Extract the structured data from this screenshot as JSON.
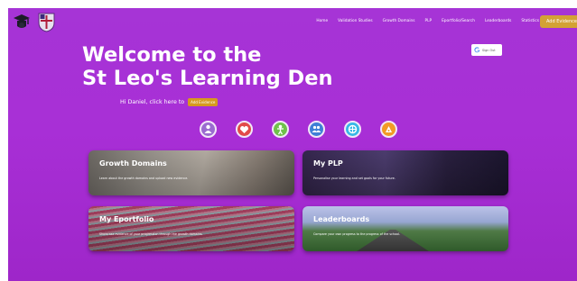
{
  "nav": {
    "links": [
      "Home",
      "Validation Studies",
      "Growth Domains",
      "PLP",
      "Eportfolio/Search",
      "Leaderboards",
      "Statistics"
    ],
    "cta_label": "Add Evidence"
  },
  "hero": {
    "title_line1": "Welcome to the",
    "title_line2": "St Leo's Learning Den"
  },
  "google": {
    "label": "Sign Out"
  },
  "greeting": {
    "text": "Hi Daniel, click here to",
    "button_label": "Add Evidence"
  },
  "icons": [
    {
      "name": "domain-1-icon",
      "color": "#9b6bd0"
    },
    {
      "name": "domain-2-icon",
      "color": "#e24a4a"
    },
    {
      "name": "domain-3-icon",
      "color": "#6fc14a"
    },
    {
      "name": "domain-4-icon",
      "color": "#3f7fd6"
    },
    {
      "name": "domain-5-icon",
      "color": "#38b8e6"
    },
    {
      "name": "domain-6-icon",
      "color": "#f29a26"
    }
  ],
  "cards": [
    {
      "title": "Growth Domains",
      "desc": "Learn about the growth domains and upload new evidence."
    },
    {
      "title": "My PLP",
      "desc": "Personalise your learning and set goals for your future."
    },
    {
      "title": "My Eportfolio",
      "desc": "Showcase evidence of your progression through the growth domains."
    },
    {
      "title": "Leaderboards",
      "desc": "Compare your own progress to the progress of the school."
    }
  ]
}
